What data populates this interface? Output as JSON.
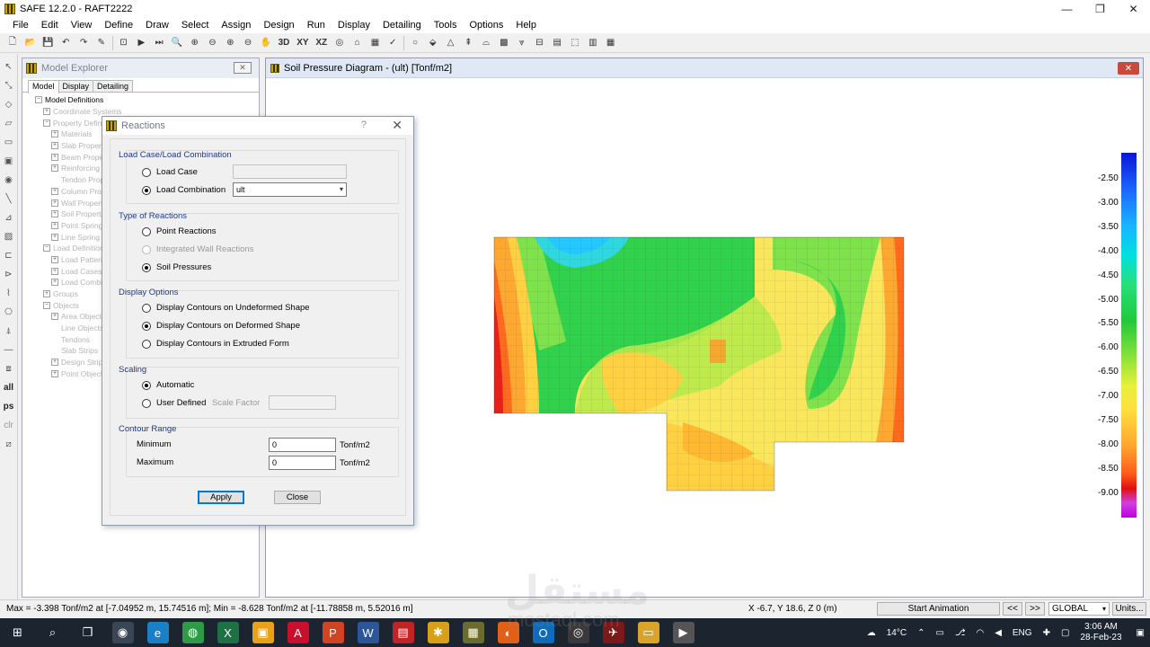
{
  "window": {
    "title": "SAFE 12.2.0 - RAFT2222",
    "minimize": "—",
    "maximize": "❐",
    "close": "✕"
  },
  "menu": [
    "File",
    "Edit",
    "View",
    "Define",
    "Draw",
    "Select",
    "Assign",
    "Design",
    "Run",
    "Display",
    "Detailing",
    "Tools",
    "Options",
    "Help"
  ],
  "toolbar": {
    "three_d": "3D",
    "xy": "XY",
    "xz": "XZ"
  },
  "left_toolbar": {
    "all": "all",
    "ps": "ps",
    "clr": "clr"
  },
  "explorer": {
    "title": "Model Explorer",
    "close": "✕",
    "tabs": [
      "Model",
      "Display",
      "Detailing"
    ],
    "tree": [
      {
        "label": "Model Definitions",
        "root": true,
        "exp": "−",
        "indent": 0
      },
      {
        "label": "Coordinate Systems",
        "exp": "+",
        "indent": 1
      },
      {
        "label": "Property Definitions",
        "exp": "−",
        "indent": 1
      },
      {
        "label": "Materials",
        "exp": "+",
        "indent": 2
      },
      {
        "label": "Slab Properties",
        "exp": "+",
        "indent": 2
      },
      {
        "label": "Beam Properties",
        "exp": "+",
        "indent": 2
      },
      {
        "label": "Reinforcing Bar Sizes",
        "exp": "+",
        "indent": 2
      },
      {
        "label": "Tendon Properties",
        "exp": "",
        "indent": 2
      },
      {
        "label": "Column Properties",
        "exp": "+",
        "indent": 2
      },
      {
        "label": "Wall Properties",
        "exp": "+",
        "indent": 2
      },
      {
        "label": "Soil Properties",
        "exp": "+",
        "indent": 2
      },
      {
        "label": "Point Spring Properties",
        "exp": "+",
        "indent": 2
      },
      {
        "label": "Line Spring Properties",
        "exp": "+",
        "indent": 2
      },
      {
        "label": "Load Definitions",
        "exp": "−",
        "indent": 1
      },
      {
        "label": "Load Patterns",
        "exp": "+",
        "indent": 2
      },
      {
        "label": "Load Cases",
        "exp": "+",
        "indent": 2
      },
      {
        "label": "Load Combinations",
        "exp": "+",
        "indent": 2
      },
      {
        "label": "Groups",
        "exp": "+",
        "indent": 1
      },
      {
        "label": "Objects",
        "exp": "−",
        "indent": 1
      },
      {
        "label": "Area Objects",
        "exp": "+",
        "indent": 2
      },
      {
        "label": "Line Objects",
        "exp": "",
        "indent": 2
      },
      {
        "label": "Tendons",
        "exp": "",
        "indent": 2
      },
      {
        "label": "Slab Strips",
        "exp": "",
        "indent": 2
      },
      {
        "label": "Design Strips",
        "exp": "+",
        "indent": 2
      },
      {
        "label": "Point Objects",
        "exp": "+",
        "indent": 2
      }
    ]
  },
  "plot": {
    "title": "Soil Pressure Diagram - (ult)  [Tonf/m2]",
    "close": "✕",
    "legend": [
      "-2.50",
      "-3.00",
      "-3.50",
      "-4.00",
      "-4.50",
      "-5.00",
      "-5.50",
      "-6.00",
      "-6.50",
      "-7.00",
      "-7.50",
      "-8.00",
      "-8.50",
      "-9.00"
    ]
  },
  "dialog": {
    "title": "Reactions",
    "help": "?",
    "close": "✕",
    "group_load": "Load Case/Load Combination",
    "load_case": "Load Case",
    "load_combination": "Load Combination",
    "combo_value": "ult",
    "group_type": "Type of Reactions",
    "point_reactions": "Point Reactions",
    "integrated_wall": "Integrated Wall Reactions",
    "soil_pressures": "Soil Pressures",
    "group_display": "Display Options",
    "undeformed": "Display Contours on Undeformed Shape",
    "deformed": "Display Contours on Deformed Shape",
    "extruded": "Display Contours in Extruded Form",
    "group_scaling": "Scaling",
    "automatic": "Automatic",
    "user_defined": "User Defined",
    "scale_factor": "Scale Factor",
    "group_range": "Contour Range",
    "minimum": "Minimum",
    "maximum": "Maximum",
    "min_value": "0",
    "max_value": "0",
    "unit": "Tonf/m2",
    "apply": "Apply",
    "close_btn": "Close"
  },
  "status": {
    "left": "Max = -3.398 Tonf/m2 at [-7.04952 m, 15.74516 m];  Min = -8.628 Tonf/m2 at [-11.78858 m, 5.52016 m]",
    "coords": "X -6.7,  Y 18.6,  Z 0  (m)",
    "start_animation": "Start Animation",
    "prev": "<<",
    "next": ">>",
    "coord_system": "GLOBAL",
    "units": "Units..."
  },
  "taskbar": {
    "weather": "14°C",
    "lang": "ENG",
    "time": "3:06 AM",
    "date": "28-Feb-23"
  },
  "watermark": {
    "arabic": "مستقل",
    "latin": "mostaql.com"
  }
}
